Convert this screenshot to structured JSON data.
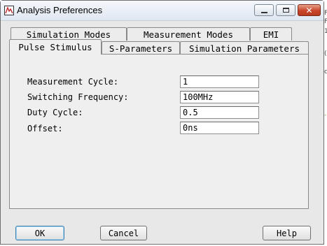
{
  "window": {
    "title": "Analysis Preferences",
    "minimize_glyph": "minimize-icon",
    "maximize_glyph": "maximize-icon",
    "close_glyph": "✕"
  },
  "tabs": {
    "row_back": [
      {
        "label": "Simulation Modes"
      },
      {
        "label": "Measurement Modes"
      },
      {
        "label": "EMI"
      }
    ],
    "row_front": [
      {
        "label": "Pulse Stimulus",
        "active": true
      },
      {
        "label": "S-Parameters"
      },
      {
        "label": "Simulation Parameters"
      }
    ]
  },
  "form": {
    "fields": [
      {
        "label": "Measurement Cycle:",
        "value": "1"
      },
      {
        "label": "Switching Frequency:",
        "value": "100MHz"
      },
      {
        "label": "Duty Cycle:",
        "value": "0.5"
      },
      {
        "label": "Offset:",
        "value": "0ns"
      }
    ]
  },
  "buttons": {
    "ok": "OK",
    "cancel": "Cancel",
    "help": "Help"
  },
  "background_edge": {
    "chars": [
      "F",
      "F",
      "1",
      "(",
      "c",
      "-"
    ]
  },
  "colors": {
    "close_button": "#c9452a",
    "focus_border": "#3c7fb1"
  }
}
